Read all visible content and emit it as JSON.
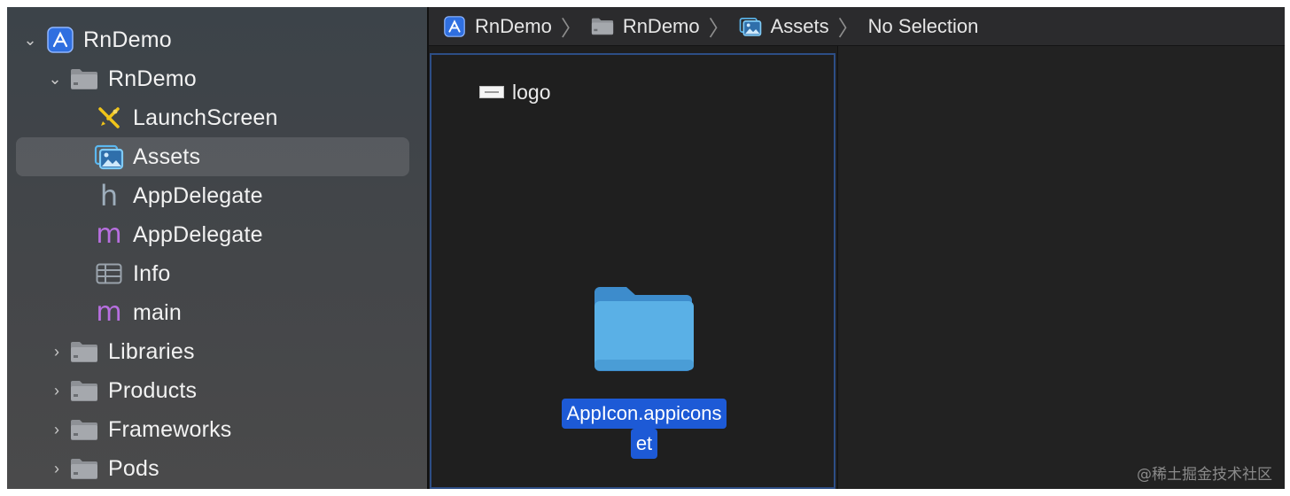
{
  "navigator": {
    "items": [
      {
        "label": "RnDemo",
        "icon": "xcode-project-icon",
        "expanded": true
      },
      {
        "label": "RnDemo",
        "icon": "folder-icon",
        "expanded": true
      },
      {
        "label": "LaunchScreen",
        "icon": "storyboard-icon"
      },
      {
        "label": "Assets",
        "icon": "asset-catalog-icon",
        "selected": true
      },
      {
        "label": "AppDelegate",
        "icon": "header-h-icon",
        "glyph": "h"
      },
      {
        "label": "AppDelegate",
        "icon": "source-m-icon",
        "glyph": "m"
      },
      {
        "label": "Info",
        "icon": "plist-table-icon"
      },
      {
        "label": "main",
        "icon": "source-m-icon",
        "glyph": "m"
      },
      {
        "label": "Libraries",
        "icon": "folder-icon",
        "expanded": false
      },
      {
        "label": "Products",
        "icon": "folder-icon",
        "expanded": false
      },
      {
        "label": "Frameworks",
        "icon": "folder-icon",
        "expanded": false
      },
      {
        "label": "Pods",
        "icon": "folder-icon",
        "expanded": false
      }
    ]
  },
  "breadcrumb": {
    "items": [
      "RnDemo",
      "RnDemo",
      "Assets",
      "No Selection"
    ]
  },
  "assets": {
    "list_item": "logo",
    "selected_folder_line1": "AppIcon.appicons",
    "selected_folder_line2": "et"
  },
  "watermark": "@稀土掘金技术社区",
  "colors": {
    "selection_blue": "#1d5ad6",
    "folder_blue": "#5ab0e6",
    "m_file_purple": "#b86fe0",
    "accent_xcode": "#3b82f6"
  }
}
